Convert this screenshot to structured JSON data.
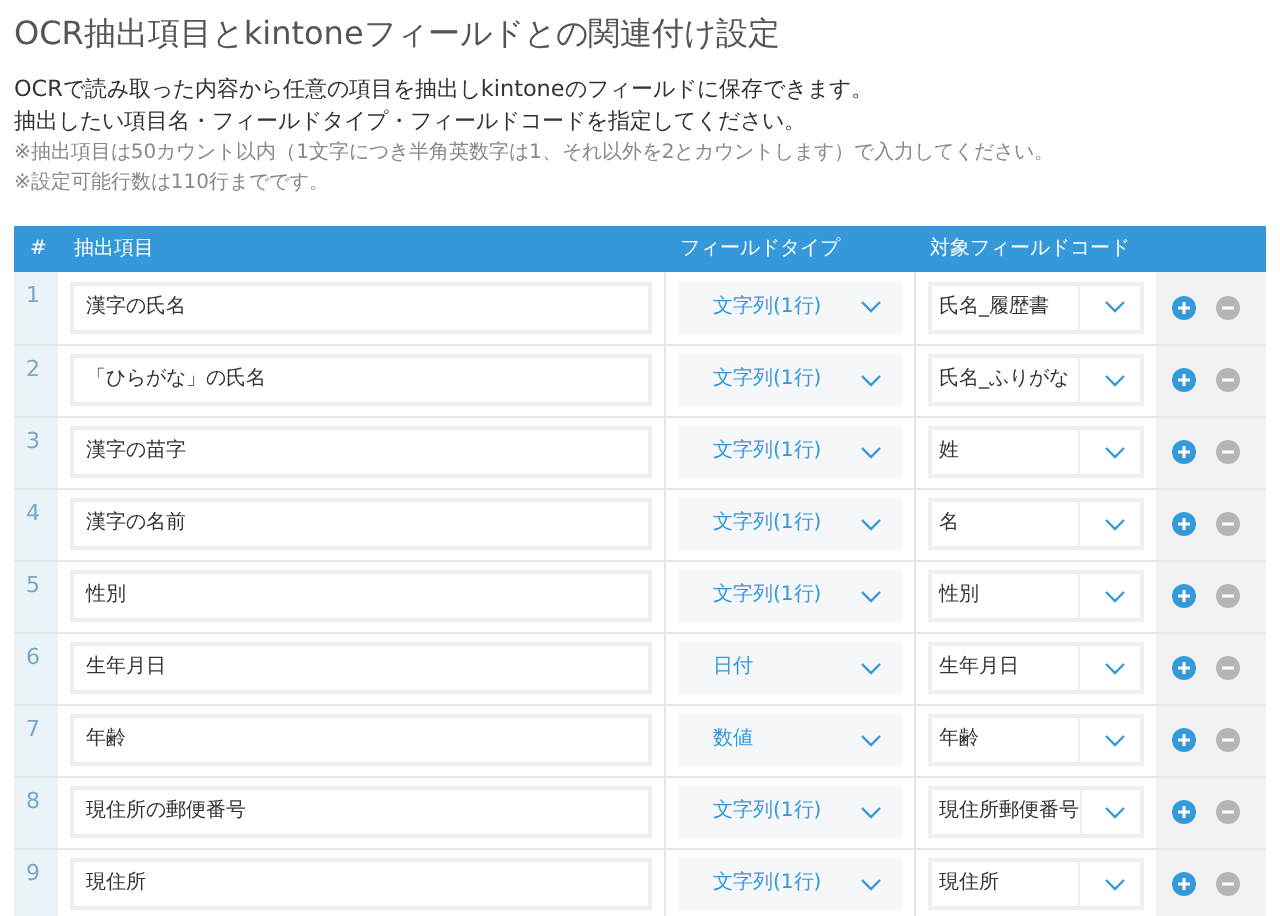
{
  "title": "OCR抽出項目とkintoneフィールドとの関連付け設定",
  "intro": [
    "OCRで読み取った内容から任意の項目を抽出しkintoneのフィールドに保存できます。",
    "抽出したい項目名・フィールドタイプ・フィールドコードを指定してください。"
  ],
  "notes": [
    "※抽出項目は50カウント以内（1文字につき半角英数字は1、それ以外を2とカウントします）で入力してください。",
    "※設定可能行数は110行までです。"
  ],
  "table": {
    "columns": [
      "#",
      "抽出項目",
      "フィールドタイプ",
      "対象フィールドコード"
    ],
    "rows": [
      {
        "number": "1",
        "item": "漢字の氏名",
        "field_type": "文字列(1行)",
        "field_code": "氏名_履歴書"
      },
      {
        "number": "2",
        "item": "「ひらがな」の氏名",
        "field_type": "文字列(1行)",
        "field_code": "氏名_ふりがな"
      },
      {
        "number": "3",
        "item": "漢字の苗字",
        "field_type": "文字列(1行)",
        "field_code": "姓"
      },
      {
        "number": "4",
        "item": "漢字の名前",
        "field_type": "文字列(1行)",
        "field_code": "名"
      },
      {
        "number": "5",
        "item": "性別",
        "field_type": "文字列(1行)",
        "field_code": "性別"
      },
      {
        "number": "6",
        "item": "生年月日",
        "field_type": "日付",
        "field_code": "生年月日"
      },
      {
        "number": "7",
        "item": "年齢",
        "field_type": "数値",
        "field_code": "年齢"
      },
      {
        "number": "8",
        "item": "現住所の郵便番号",
        "field_type": "文字列(1行)",
        "field_code": "現住所郵便番号"
      },
      {
        "number": "9",
        "item": "現住所",
        "field_type": "文字列(1行)",
        "field_code": "現住所"
      }
    ]
  }
}
